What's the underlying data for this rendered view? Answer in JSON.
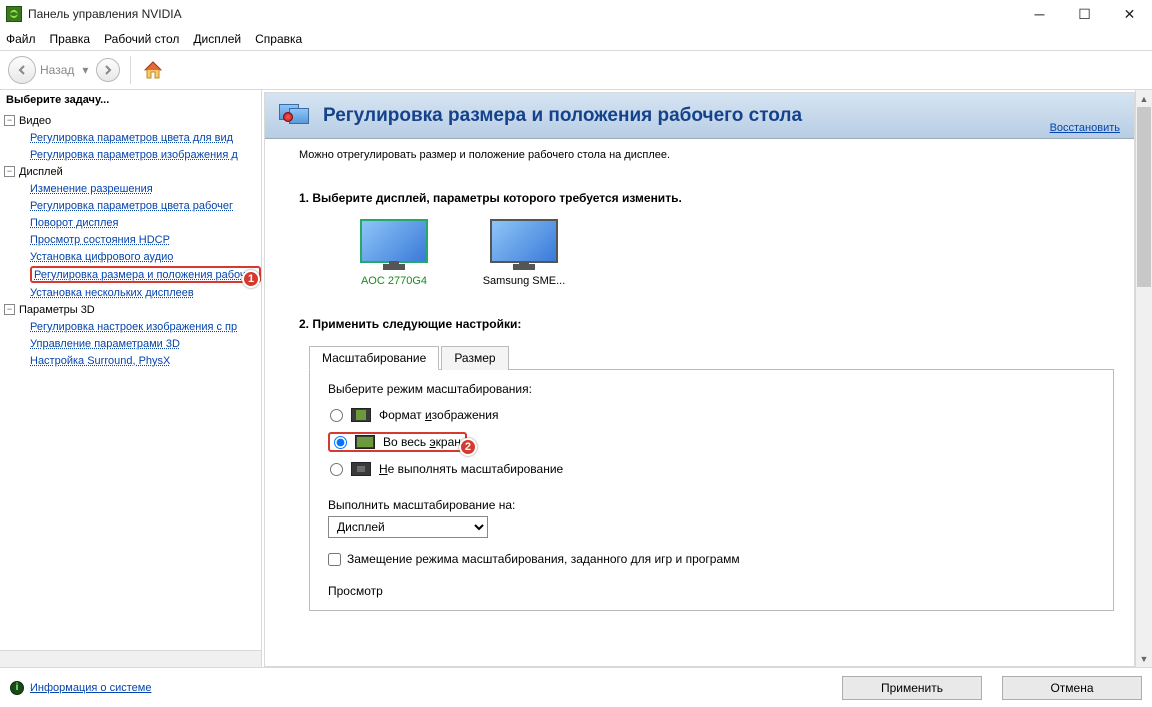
{
  "window": {
    "title": "Панель управления NVIDIA"
  },
  "menubar": {
    "file": "Файл",
    "edit": "Правка",
    "desktop": "Рабочий стол",
    "display": "Дисплей",
    "help": "Справка"
  },
  "toolbar": {
    "back": "Назад"
  },
  "sidebar": {
    "header": "Выберите задачу...",
    "cat_video": "Видео",
    "video_items": [
      "Регулировка параметров цвета для вид",
      "Регулировка параметров изображения д"
    ],
    "cat_display": "Дисплей",
    "display_items": [
      "Изменение разрешения",
      "Регулировка параметров цвета рабочег",
      "Поворот дисплея",
      "Просмотр состояния HDCP",
      "Установка цифрового аудио",
      "Регулировка размера и положения рабоч",
      "Установка нескольких дисплеев"
    ],
    "cat_3d": "Параметры 3D",
    "d3_items": [
      "Регулировка настроек изображения с пр",
      "Управление параметрами 3D",
      "Настройка Surround, PhysX"
    ]
  },
  "page": {
    "title": "Регулировка размера и положения рабочего стола",
    "restore": "Восстановить",
    "desc": "Можно отрегулировать размер и положение рабочего стола на дисплее.",
    "step1": "1. Выберите дисплей, параметры которого требуется изменить.",
    "displays": [
      {
        "name": "AOC 2770G4",
        "selected": true
      },
      {
        "name": "Samsung SME...",
        "selected": false
      }
    ],
    "step2": "2. Применить следующие настройки:",
    "tabs": {
      "scaling": "Масштабирование",
      "size": "Размер"
    },
    "scaling_mode_label": "Выберите режим масштабирования:",
    "radios": {
      "aspect_pre": "Формат ",
      "aspect_key": "и",
      "aspect_post": "зображения",
      "full_pre": "Во весь ",
      "full_key": "э",
      "full_post": "кран",
      "none_key": "Н",
      "none_post": "е выполнять масштабирование"
    },
    "perform_on_label": "Выполнить масштабирование на:",
    "perform_on_value": "Дисплей",
    "override_label": "Замещение режима масштабирования, заданного для игр и программ",
    "preview": "Просмотр"
  },
  "footer": {
    "sysinfo": "Информация о системе",
    "apply": "Применить",
    "cancel": "Отмена"
  },
  "callouts": {
    "one": "1",
    "two": "2"
  }
}
